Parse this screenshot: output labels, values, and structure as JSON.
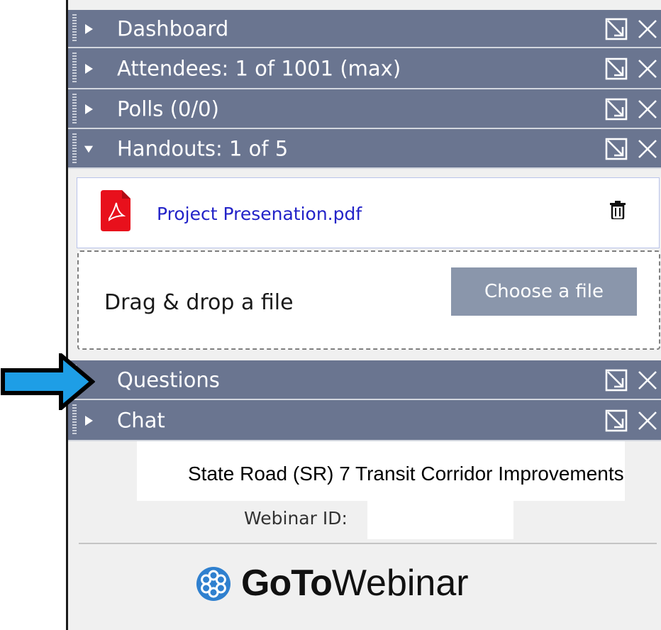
{
  "panels": {
    "dashboard": {
      "label": "Dashboard"
    },
    "attendees": {
      "label": "Attendees:  1 of 1001 (max)"
    },
    "polls": {
      "label": "Polls (0/0)"
    },
    "handouts": {
      "label": "Handouts: 1 of 5"
    },
    "questions": {
      "label": "Questions"
    },
    "chat": {
      "label": "Chat"
    }
  },
  "handouts": {
    "file_name": "Project Presenation.pdf",
    "drop_label": "Drag & drop a file",
    "choose_label": "Choose a file"
  },
  "webinar": {
    "title": "State Road (SR) 7 Transit Corridor Improvements",
    "id_label": "Webinar ID:",
    "id_value": ""
  },
  "logo": {
    "bold": "GoTo",
    "light": "Webinar"
  },
  "colors": {
    "bar": "#6a7590",
    "link": "#2323c8",
    "pdf": "#e8101c",
    "arrow": "#1e9ee6",
    "button": "#8a96ab"
  },
  "icons": [
    "expand-arrow-icon",
    "collapse-arrow-icon",
    "popout-icon",
    "close-icon",
    "pdf-icon",
    "trash-icon",
    "gotowebinar-logo-icon",
    "pointer-arrow-icon"
  ]
}
